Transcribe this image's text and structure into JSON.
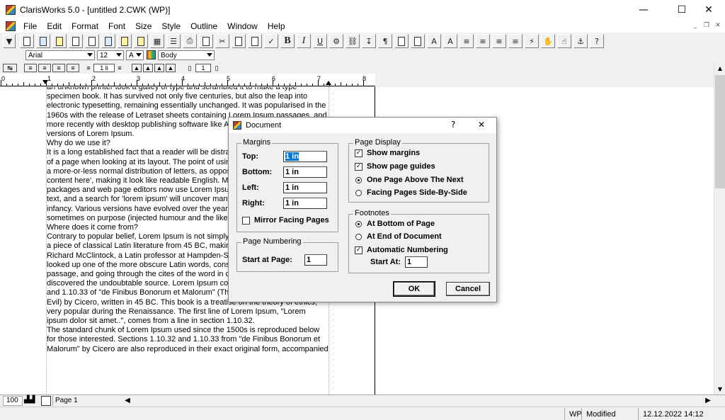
{
  "window": {
    "title": "ClarisWorks 5.0 - [untitled 2.CWK (WP)]",
    "minimize": "—",
    "maximize": "☐",
    "close": "✕"
  },
  "menu": [
    "File",
    "Edit",
    "Format",
    "Font",
    "Size",
    "Style",
    "Outline",
    "Window",
    "Help"
  ],
  "format_bar": {
    "font": "Arial",
    "size": "12",
    "text_color": "A",
    "style": "Body"
  },
  "ruler_bar": {
    "spacing": "1 li",
    "columns": "1"
  },
  "ruler": {
    "numbers": [
      "0",
      "1",
      "2",
      "3",
      "4",
      "5",
      "6",
      "7",
      "8"
    ]
  },
  "document": {
    "paragraphs": [
      "an unknown printer took a galley of type and scrambled it to make a type specimen book. It has survived not only five centuries, but also the leap into electronic typesetting, remaining essentially unchanged. It was popularised in the 1960s with the release of Letraset sheets containing Lorem Ipsum passages, and more recently with desktop publishing software like Aldus PageMaker including versions of Lorem Ipsum.",
      "",
      "Why do we use it?\nIt is a long established fact that a reader will be distracted by the readable content of a page when looking at its layout. The point of using Lorem Ipsum is that it has a more-or-less normal distribution of letters, as opposed to using 'Content here, content here', making it look like readable English. Many desktop publishing packages and web page editors now use Lorem Ipsum as their default model text, and a search for 'lorem ipsum' will uncover many web sites still in their infancy. Various versions have evolved over the years, sometimes by accident, sometimes on purpose (injected humour and the like).",
      "",
      "",
      "Where does it come from?\nContrary to popular belief, Lorem Ipsum is not simply random text. It has roots in a piece of classical Latin literature from 45 BC, making it over 2000 years old. Richard McClintock, a Latin professor at Hampden-Sydney College in Virginia, looked up one of the more obscure Latin words, consectetur, from a Lorem Ipsum passage, and going through the cites of the word in classical literature, discovered the undoubtable source. Lorem Ipsum comes from sections 1.10.32 and 1.10.33 of \"de Finibus Bonorum et Malorum\" (The Extremes of Good and Evil) by Cicero, written in 45 BC. This book is a treatise on the theory of ethics, very popular during the Renaissance. The first line of Lorem Ipsum, \"Lorem ipsum dolor sit amet..\", comes from a line in section 1.10.32.",
      "",
      "The standard chunk of Lorem Ipsum used since the 1500s is reproduced below for those interested. Sections 1.10.32 and 1.10.33 from \"de Finibus Bonorum et Malorum\" by Cicero are also reproduced in their exact original form, accompanied"
    ]
  },
  "bottom": {
    "zoom": "100",
    "page": "Page 1"
  },
  "status": {
    "mode": "WP",
    "modified": "Modified",
    "datetime": "12.12.2022 14:12"
  },
  "dialog": {
    "title": "Document",
    "help": "?",
    "close": "✕",
    "margins": {
      "label": "Margins",
      "top_label": "Top:",
      "top": "1 in",
      "bottom_label": "Bottom:",
      "bottom": "1 in",
      "left_label": "Left:",
      "left": "1 in",
      "right_label": "Right:",
      "right": "1 in",
      "mirror_label": "Mirror Facing Pages"
    },
    "page_numbering": {
      "label": "Page Numbering",
      "start_label": "Start at Page:",
      "start": "1"
    },
    "page_display": {
      "label": "Page Display",
      "show_margins": "Show margins",
      "show_guides": "Show page guides",
      "one_page": "One Page Above The Next",
      "facing": "Facing Pages Side-By-Side"
    },
    "footnotes": {
      "label": "Footnotes",
      "bottom": "At Bottom of Page",
      "end": "At End of Document",
      "auto": "Automatic Numbering",
      "start_label": "Start At:",
      "start": "1"
    },
    "ok": "OK",
    "cancel": "Cancel"
  }
}
